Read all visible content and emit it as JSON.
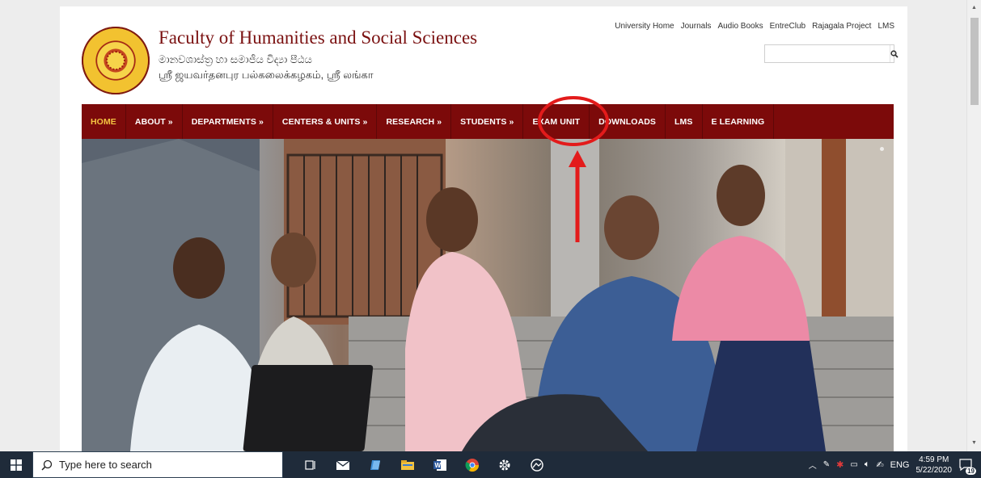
{
  "header": {
    "title": "Faculty of Humanities and Social Sciences",
    "subtitle_sinhala": "මානවශාස්ත්‍ර හා සමාජීය විද්‍යා පීඨය",
    "subtitle_tamil": "ஸ்ரீ ஜயவர்தனபுர பல்கலைக்கழகம், ஸ்ரீ லங்கா",
    "logo_icon": "university-crest",
    "top_links": [
      "University Home",
      "Journals",
      "Audio Books",
      "EntreClub",
      "Rajagala Project",
      "LMS"
    ],
    "search": {
      "value": "",
      "placeholder": "",
      "button_icon": "magnifier-icon"
    }
  },
  "nav": {
    "items": [
      {
        "label": "HOME",
        "active": true
      },
      {
        "label": "ABOUT »"
      },
      {
        "label": "DEPARTMENTS »"
      },
      {
        "label": "CENTERS & UNITS »"
      },
      {
        "label": "RESEARCH »"
      },
      {
        "label": "STUDENTS »"
      },
      {
        "label": "EXAM UNIT",
        "highlighted": true
      },
      {
        "label": "DOWNLOADS"
      },
      {
        "label": "LMS"
      },
      {
        "label": "E LEARNING"
      }
    ],
    "background": "#7c0a0a",
    "active_color": "#f4c542"
  },
  "hero": {
    "image": "students-on-steps-photo"
  },
  "annotation": {
    "color": "#e31b1b",
    "target": "EXAM UNIT"
  },
  "taskbar": {
    "search_placeholder": "Type here to search",
    "apps": [
      "task-view-icon",
      "mail-icon",
      "sticky-notes-icon",
      "file-explorer-icon",
      "word-icon",
      "chrome-icon",
      "settings-icon",
      "photos-icon"
    ],
    "tray": {
      "language": "ENG",
      "time": "4:59 PM",
      "date": "5/22/2020",
      "notifications": "19"
    }
  }
}
